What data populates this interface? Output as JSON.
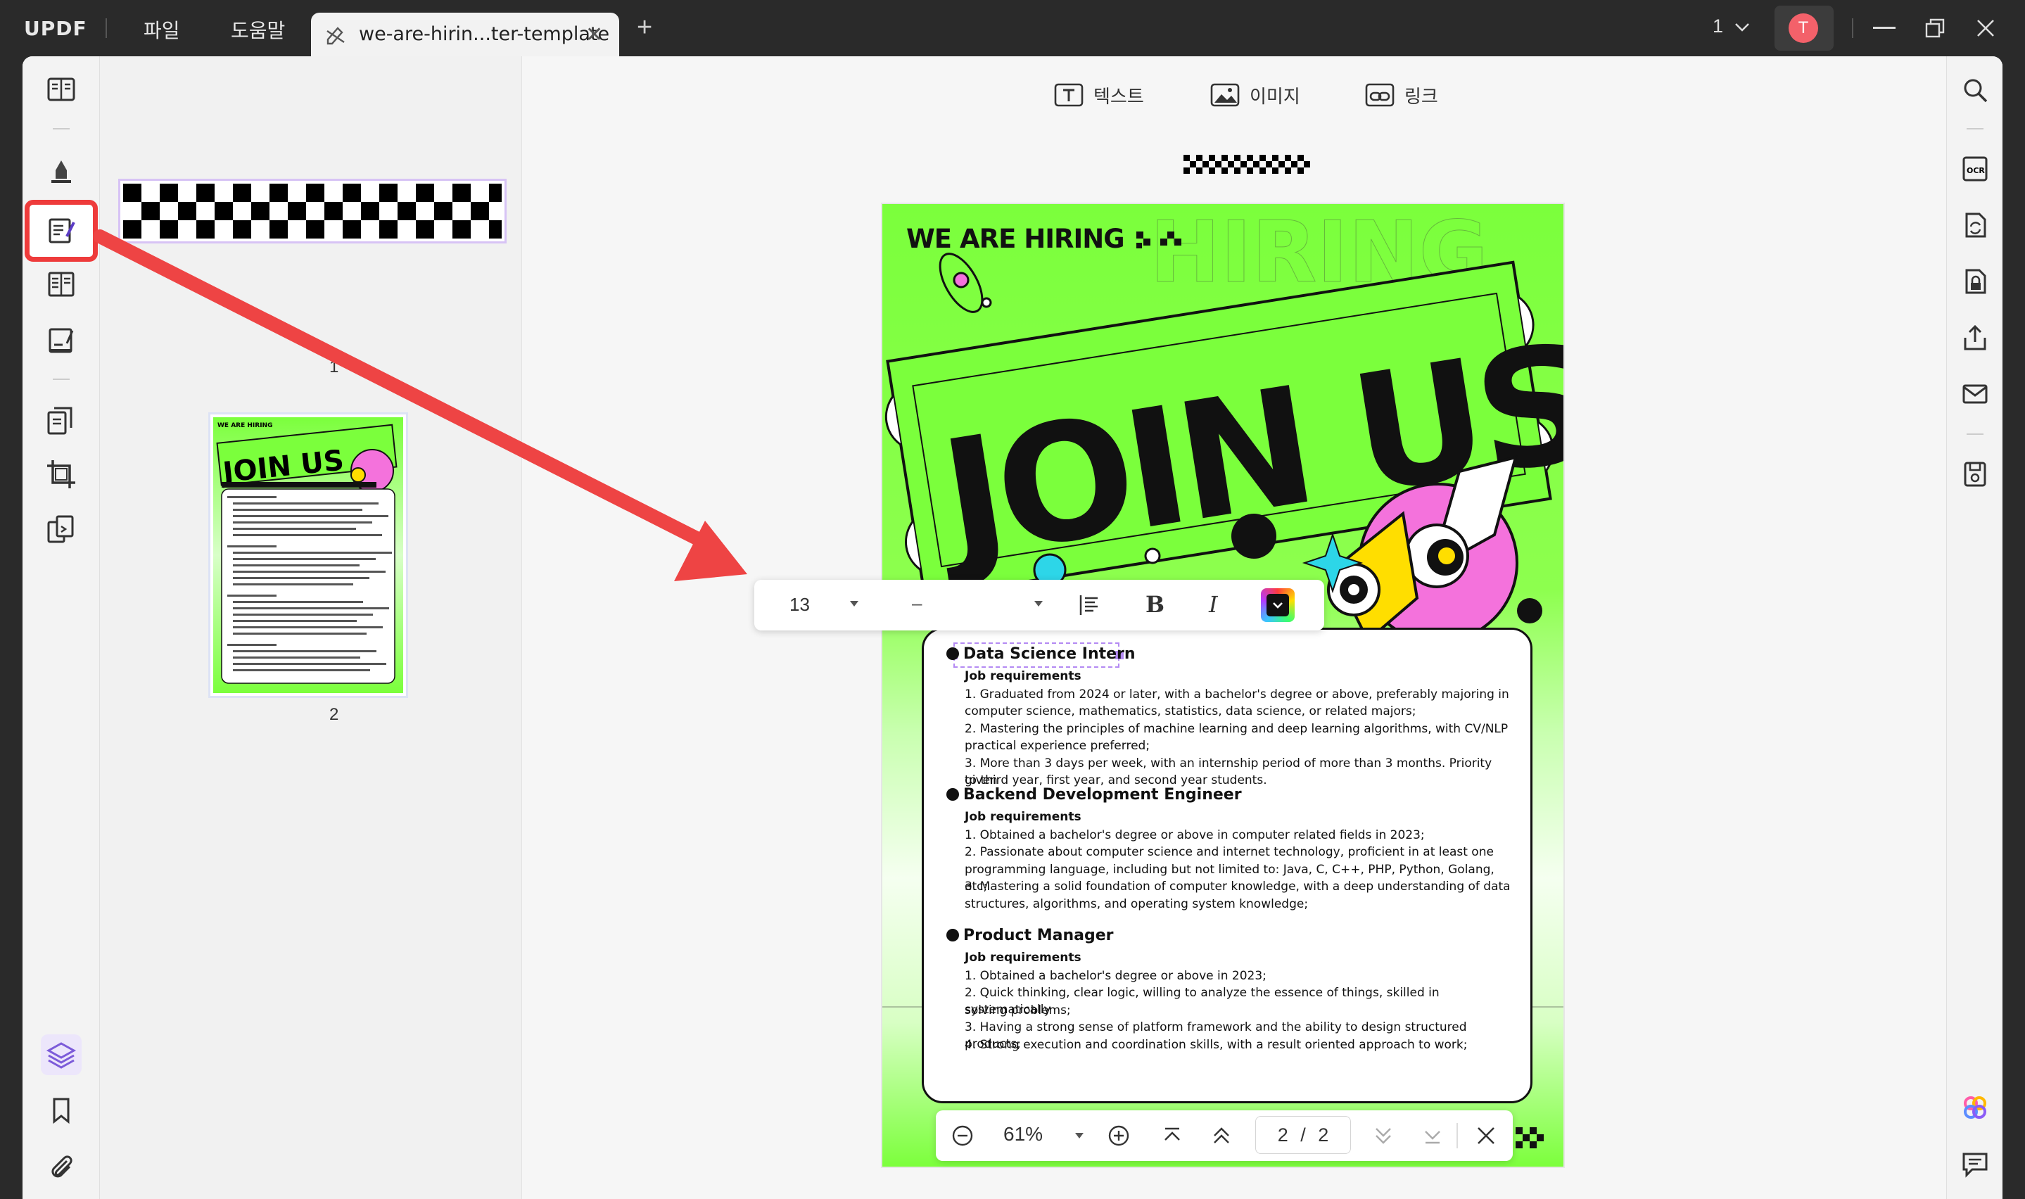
{
  "app": {
    "logo": "UPDF",
    "menu": [
      "파일",
      "도움말"
    ],
    "tab_title": "we-are-hirin...ter-template",
    "tab_close": "✕",
    "new_tab": "+",
    "page_count": "1",
    "avatar_initial": "T"
  },
  "edit_tools": {
    "text": "텍스트",
    "image": "이미지",
    "link": "링크"
  },
  "thumbnails": [
    {
      "label": "1"
    },
    {
      "label": "2"
    }
  ],
  "document": {
    "hiring": "WE ARE HIRING",
    "join": "JOIN US",
    "jobs": [
      {
        "title": "Data Science Intern",
        "req_label": "Job requirements",
        "lines": [
          "1. Graduated from 2024 or later, with a bachelor's degree or above, preferably majoring in",
          "computer science, mathematics, statistics, data science, or related majors;",
          "2. Mastering the principles of machine learning and deep learning algorithms, with CV/NLP",
          "practical experience preferred;",
          "3. More than 3 days per week, with an internship period of more than 3 months. Priority given",
          "to third year, first year, and second year students."
        ]
      },
      {
        "title": "Backend Development Engineer",
        "req_label": "Job requirements",
        "lines": [
          "1. Obtained a bachelor's degree or above in computer related fields in 2023;",
          "2. Passionate about computer science and internet technology, proficient in at least one",
          "programming language, including but not limited to: Java, C, C++, PHP, Python, Golang, etc;",
          "3. Mastering a solid foundation of computer knowledge, with a deep understanding of data",
          "structures, algorithms, and operating system knowledge;"
        ]
      },
      {
        "title": "Product Manager",
        "req_label": "Job requirements",
        "lines": [
          "1. Obtained a bachelor's degree or above in 2023;",
          "2. Quick thinking, clear logic, willing to analyze the essence of things, skilled in systematically",
          "solving problems;",
          "3. Having a strong sense of platform framework and the ability to design structured products;",
          "4. Strong execution and coordination skills, with a result oriented approach to work;"
        ]
      }
    ]
  },
  "format_toolbar": {
    "font_size": "13",
    "font_name": "–",
    "bold": "B",
    "italic": "I"
  },
  "zoom_bar": {
    "zoom": "61%",
    "page_current": "2",
    "page_sep": "/",
    "page_total": "2"
  },
  "colors": {
    "accent_red": "#ee3b3b",
    "poster_green": "#7bff3c",
    "selection_purple": "#b48af3"
  }
}
